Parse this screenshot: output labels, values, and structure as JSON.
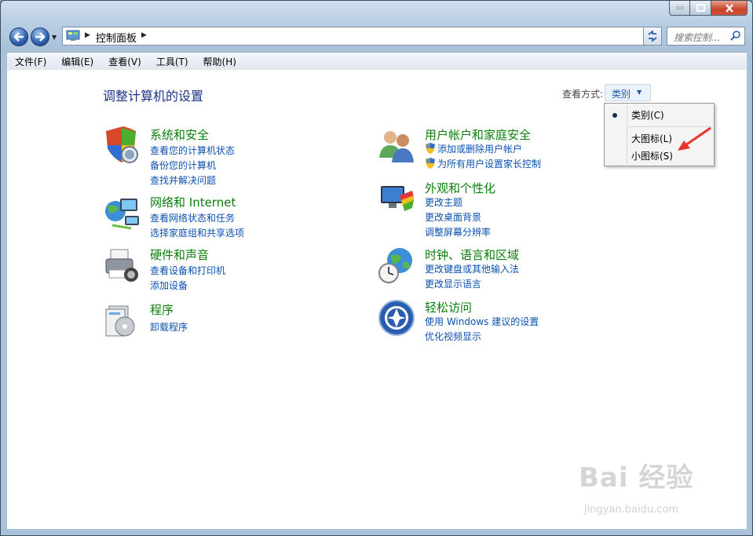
{
  "window": {
    "address_path": "控制面板",
    "search_placeholder": "搜索控制..."
  },
  "menu": [
    "文件(F)",
    "编辑(E)",
    "查看(V)",
    "工具(T)",
    "帮助(H)"
  ],
  "page_title": "调整计算机的设置",
  "view_by": {
    "label": "查看方式:",
    "value": "类别"
  },
  "dropdown": {
    "items": [
      "类别(C)",
      "大图标(L)",
      "小图标(S)"
    ],
    "selected": "类别(C)"
  },
  "categories": [
    {
      "title": "系统和安全",
      "icon": "shield-icon",
      "links": [
        "查看您的计算机状态",
        "备份您的计算机",
        "查找并解决问题"
      ]
    },
    {
      "title": "网络和 Internet",
      "icon": "network-icon",
      "links": [
        "查看网络状态和任务",
        "选择家庭组和共享选项"
      ]
    },
    {
      "title": "硬件和声音",
      "icon": "printer-icon",
      "links": [
        "查看设备和打印机",
        "添加设备"
      ]
    },
    {
      "title": "程序",
      "icon": "programs-icon",
      "links": [
        "卸载程序"
      ]
    },
    {
      "title": "用户帐户和家庭安全",
      "icon": "users-icon",
      "links": [
        "添加或删除用户帐户",
        "为所有用户设置家长控制"
      ]
    },
    {
      "title": "外观和个性化",
      "icon": "appearance-icon",
      "links": [
        "更改主题",
        "更改桌面背景",
        "调整屏幕分辨率"
      ]
    },
    {
      "title": "时钟、语言和区域",
      "icon": "clock-globe-icon",
      "links": [
        "更改键盘或其他输入法",
        "更改显示语言"
      ]
    },
    {
      "title": "轻松访问",
      "icon": "ease-of-access-icon",
      "links": [
        "使用 Windows 建议的设置",
        "优化视频显示"
      ]
    }
  ],
  "watermark": {
    "brand": "Bai 经验",
    "url": "jingyan.baidu.com"
  },
  "colors": {
    "category_title": "#0a7e0a",
    "link": "#0b50b0",
    "page_title": "#1e3287"
  }
}
